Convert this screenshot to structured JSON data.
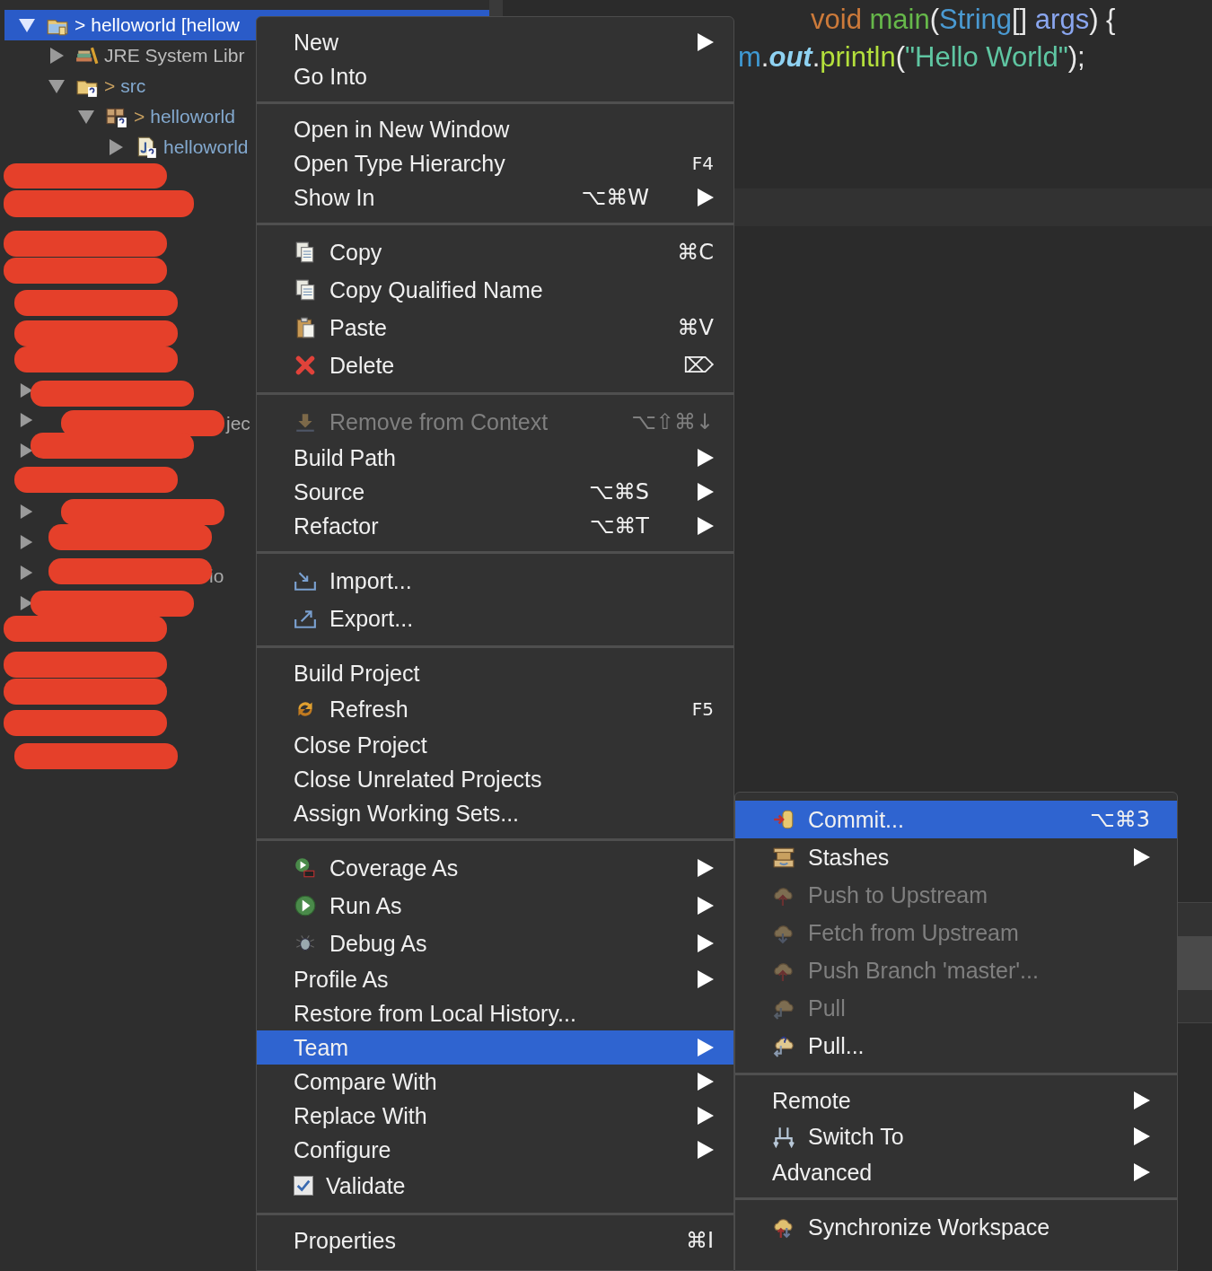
{
  "tree": [
    {
      "kind": "project",
      "decoration": ">",
      "label": "helloworld [hellow",
      "expanded": true,
      "selected": true,
      "children": [
        {
          "kind": "library",
          "label": "JRE System Libr",
          "expanded": false,
          "selected": false
        },
        {
          "kind": "source-folder",
          "decoration": ">",
          "label": "src",
          "expanded": true,
          "selected": false,
          "children": [
            {
              "kind": "package",
              "decoration": ">",
              "label": "helloworld",
              "expanded": true,
              "selected": false,
              "children": [
                {
                  "kind": "file",
                  "label": "helloworld",
                  "expanded": false,
                  "selected": false
                }
              ]
            }
          ]
        }
      ]
    }
  ],
  "tree_fragments": [
    {
      "text": "jec"
    },
    {
      "text": "io"
    }
  ],
  "editor": {
    "lines": [
      {
        "tokens": [
          {
            "kind": "keyword",
            "text": "void "
          },
          {
            "kind": "method",
            "text": "main"
          },
          {
            "kind": "punct",
            "text": "("
          },
          {
            "kind": "type",
            "text": "String"
          },
          {
            "kind": "punct",
            "text": "[] "
          },
          {
            "kind": "param",
            "text": "args"
          },
          {
            "kind": "punct",
            "text": ") {"
          }
        ]
      },
      {
        "tokens": [
          {
            "kind": "ref",
            "text": "m"
          },
          {
            "kind": "punct",
            "text": "."
          },
          {
            "kind": "field",
            "text": "out"
          },
          {
            "kind": "punct",
            "text": "."
          },
          {
            "kind": "call",
            "text": "println"
          },
          {
            "kind": "punct",
            "text": "("
          },
          {
            "kind": "string",
            "text": "\"Hello World\""
          },
          {
            "kind": "punct",
            "text": ");"
          }
        ]
      }
    ]
  },
  "menu": {
    "groups": [
      {
        "items": [
          {
            "kind": "text",
            "label": "New",
            "submenu": true,
            "disabled": false,
            "selected": false
          },
          {
            "kind": "text",
            "label": "Go Into",
            "submenu": false,
            "disabled": false,
            "selected": false
          }
        ]
      },
      {
        "items": [
          {
            "kind": "text",
            "label": "Open in New Window",
            "submenu": false,
            "disabled": false,
            "selected": false
          },
          {
            "kind": "text",
            "label": "Open Type Hierarchy",
            "shortcut": "F4",
            "submenu": false,
            "disabled": false,
            "selected": false
          },
          {
            "kind": "text",
            "label": "Show In",
            "shortcut": "⌥⌘W",
            "submenu": true,
            "disabled": false,
            "selected": false
          }
        ]
      },
      {
        "items": [
          {
            "kind": "copy",
            "label": "Copy",
            "shortcut": "⌘C",
            "submenu": false,
            "disabled": false,
            "selected": false
          },
          {
            "kind": "copy-name",
            "label": "Copy Qualified Name",
            "submenu": false,
            "disabled": false,
            "selected": false
          },
          {
            "kind": "paste",
            "label": "Paste",
            "shortcut": "⌘V",
            "submenu": false,
            "disabled": false,
            "selected": false
          },
          {
            "kind": "delete",
            "label": "Delete",
            "shortcut": "⌦",
            "submenu": false,
            "disabled": false,
            "selected": false
          }
        ]
      },
      {
        "items": [
          {
            "kind": "remove-context",
            "label": "Remove from Context",
            "shortcut": "⌥⇧⌘↓",
            "submenu": false,
            "disabled": true,
            "selected": false
          },
          {
            "kind": "text",
            "label": "Build Path",
            "submenu": true,
            "disabled": false,
            "selected": false
          },
          {
            "kind": "text",
            "label": "Source",
            "shortcut": "⌥⌘S",
            "submenu": true,
            "disabled": false,
            "selected": false
          },
          {
            "kind": "text",
            "label": "Refactor",
            "shortcut": "⌥⌘T",
            "submenu": true,
            "disabled": false,
            "selected": false
          }
        ]
      },
      {
        "items": [
          {
            "kind": "import",
            "label": "Import...",
            "submenu": false,
            "disabled": false,
            "selected": false
          },
          {
            "kind": "export",
            "label": "Export...",
            "submenu": false,
            "disabled": false,
            "selected": false
          }
        ]
      },
      {
        "items": [
          {
            "kind": "text",
            "label": "Build Project",
            "submenu": false,
            "disabled": false,
            "selected": false
          },
          {
            "kind": "refresh",
            "label": "Refresh",
            "shortcut": "F5",
            "submenu": false,
            "disabled": false,
            "selected": false
          },
          {
            "kind": "text",
            "label": "Close Project",
            "submenu": false,
            "disabled": false,
            "selected": false
          },
          {
            "kind": "text",
            "label": "Close Unrelated Projects",
            "submenu": false,
            "disabled": false,
            "selected": false
          },
          {
            "kind": "text",
            "label": "Assign Working Sets...",
            "submenu": false,
            "disabled": false,
            "selected": false
          }
        ]
      },
      {
        "items": [
          {
            "kind": "coverage",
            "label": "Coverage As",
            "submenu": true,
            "disabled": false,
            "selected": false
          },
          {
            "kind": "run",
            "label": "Run As",
            "submenu": true,
            "disabled": false,
            "selected": false
          },
          {
            "kind": "debug",
            "label": "Debug As",
            "submenu": true,
            "disabled": false,
            "selected": false
          },
          {
            "kind": "text",
            "label": "Profile As",
            "submenu": true,
            "disabled": false,
            "selected": false
          },
          {
            "kind": "text",
            "label": "Restore from Local History...",
            "submenu": false,
            "disabled": false,
            "selected": false
          },
          {
            "kind": "text",
            "label": "Team",
            "submenu": true,
            "disabled": false,
            "selected": true
          },
          {
            "kind": "text",
            "label": "Compare With",
            "submenu": true,
            "disabled": false,
            "selected": false
          },
          {
            "kind": "text",
            "label": "Replace With",
            "submenu": true,
            "disabled": false,
            "selected": false
          },
          {
            "kind": "text",
            "label": "Configure",
            "submenu": true,
            "disabled": false,
            "selected": false
          },
          {
            "kind": "checkbox",
            "label": "Validate",
            "checked": true,
            "submenu": false,
            "disabled": false,
            "selected": false
          }
        ]
      },
      {
        "items": [
          {
            "kind": "text",
            "label": "Properties",
            "shortcut": "⌘I",
            "submenu": false,
            "disabled": false,
            "selected": false
          }
        ]
      }
    ]
  },
  "submenu": {
    "groups": [
      {
        "items": [
          {
            "kind": "commit",
            "label": "Commit...",
            "shortcut": "⌥⌘3",
            "submenu": false,
            "disabled": false,
            "selected": true
          },
          {
            "kind": "stashes",
            "label": "Stashes",
            "submenu": true,
            "disabled": false,
            "selected": false
          },
          {
            "kind": "cloud-up",
            "label": "Push to Upstream",
            "submenu": false,
            "disabled": true,
            "selected": false
          },
          {
            "kind": "cloud-down",
            "label": "Fetch from Upstream",
            "submenu": false,
            "disabled": true,
            "selected": false
          },
          {
            "kind": "cloud-up",
            "label": "Push Branch 'master'...",
            "submenu": false,
            "disabled": true,
            "selected": false
          },
          {
            "kind": "pull",
            "label": "Pull",
            "submenu": false,
            "disabled": true,
            "selected": false
          },
          {
            "kind": "pull-dialog",
            "label": "Pull...",
            "submenu": false,
            "disabled": false,
            "selected": false
          }
        ]
      },
      {
        "items": [
          {
            "kind": "text",
            "label": "Remote",
            "submenu": true,
            "disabled": false,
            "selected": false
          },
          {
            "kind": "switch",
            "label": "Switch To",
            "submenu": true,
            "disabled": false,
            "selected": false
          },
          {
            "kind": "text",
            "label": "Advanced",
            "submenu": true,
            "disabled": false,
            "selected": false
          }
        ]
      },
      {
        "items": [
          {
            "kind": "sync",
            "label": "Synchronize Workspace",
            "submenu": false,
            "disabled": false,
            "selected": false
          }
        ]
      }
    ]
  }
}
